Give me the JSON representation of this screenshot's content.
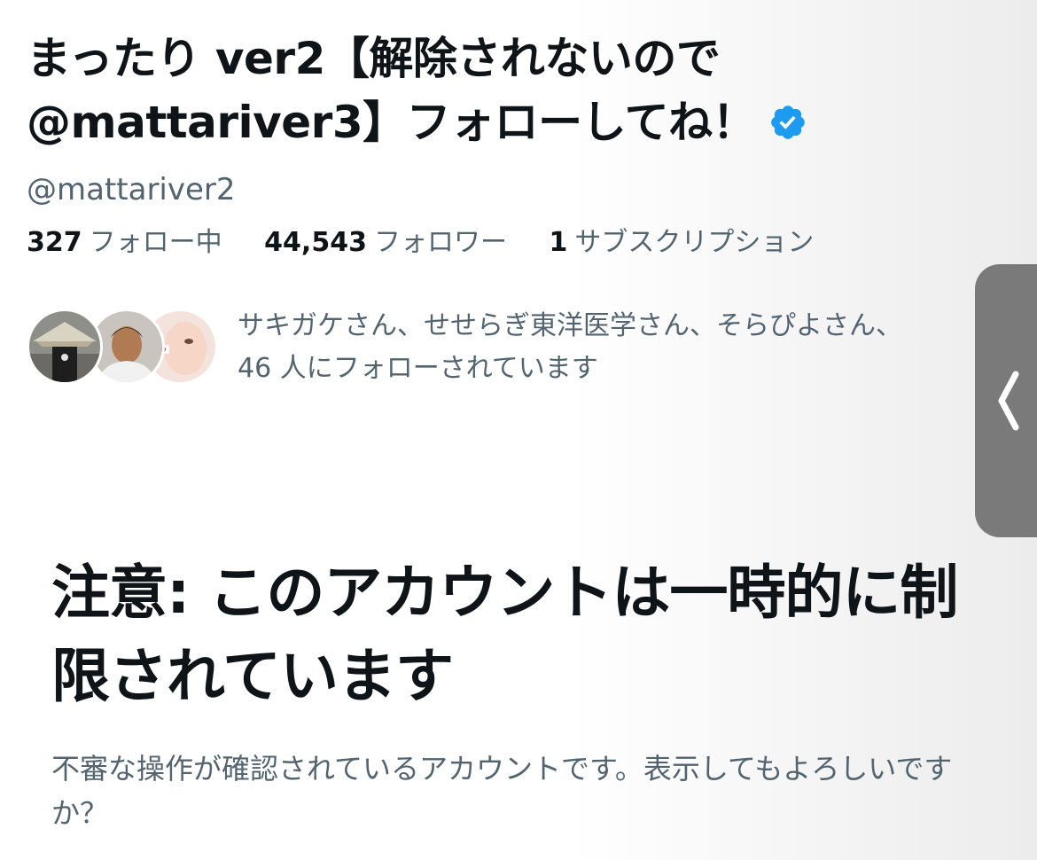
{
  "profile": {
    "display_name": "まったり ver2【解除されないので@mattariver3】フォローしてね！",
    "handle": "@mattariver2",
    "verified_icon": "verified-badge-icon",
    "accent_color": "#1d9bf0"
  },
  "stats": {
    "following": {
      "count": "327",
      "label": "フォロー中"
    },
    "followers": {
      "count": "44,543",
      "label": "フォロワー"
    },
    "subscriptions": {
      "count": "1",
      "label": "サブスクリプション"
    }
  },
  "followed_by": {
    "line1": "サキガケさん、せせらぎ東洋医学さん、そらぴよさん、",
    "line2": "46 人にフォローされています"
  },
  "side_tab": {
    "icon": "chevron-left-icon"
  },
  "warning": {
    "title": "注意: このアカウントは一時的に制限されています",
    "body": "不審な操作が確認されているアカウントです。表示してもよろしいですか？"
  }
}
